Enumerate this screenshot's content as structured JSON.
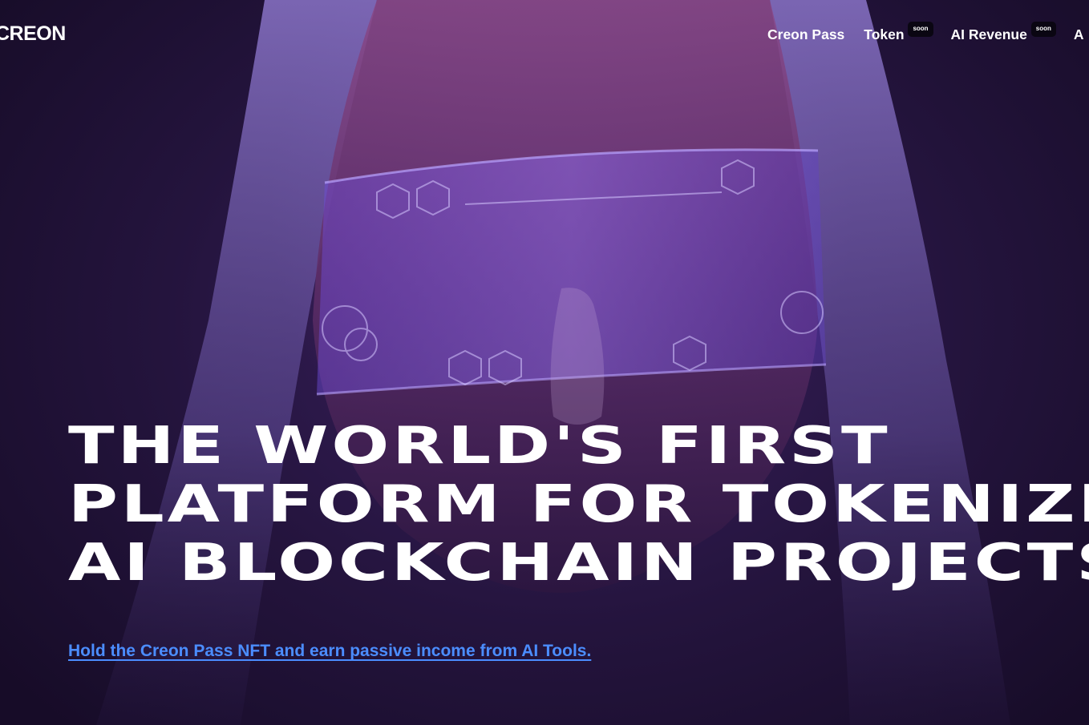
{
  "header": {
    "logo_text": "CREON",
    "nav": [
      {
        "label": "Creon Pass",
        "badge": ""
      },
      {
        "label": "Token",
        "badge": "soon"
      },
      {
        "label": "AI Revenue",
        "badge": "soon"
      },
      {
        "label": "A",
        "badge": ""
      }
    ]
  },
  "hero": {
    "headline_lines": [
      "THE WORLD'S FIRST",
      "PLATFORM FOR TOKENIZING",
      "AI BLOCKCHAIN PROJECTS."
    ],
    "cta_link": "Hold the Creon Pass NFT and earn passive income from AI Tools."
  },
  "colors": {
    "background": "#24143d",
    "link": "#4b8dff",
    "badge": "#0a0612",
    "text": "#ffffff"
  }
}
